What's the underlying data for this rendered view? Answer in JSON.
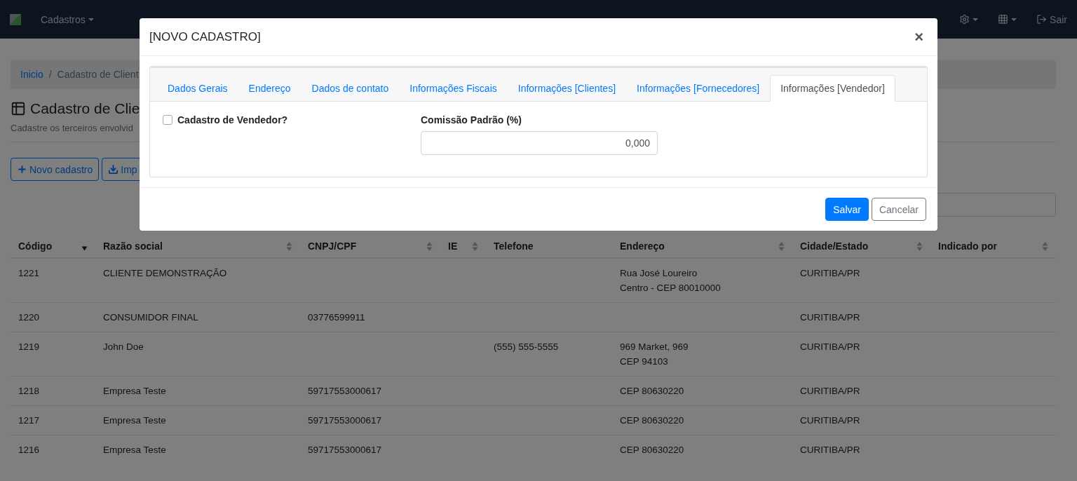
{
  "navbar": {
    "menu": [
      {
        "label": "Cadastros"
      }
    ],
    "logout": "Sair"
  },
  "breadcrumb": {
    "home": "Inicio",
    "separator": "/",
    "current": "Cadastro de Client"
  },
  "page": {
    "title": "Cadastro de Clie",
    "subtitle": "Cadastre os terceiros envolvid",
    "buttons": [
      {
        "kind": "new",
        "label": "Novo cadastro"
      },
      {
        "kind": "import",
        "label": "Imp"
      }
    ]
  },
  "table": {
    "columns": [
      {
        "label": "Código",
        "sortable": true,
        "sorted": true
      },
      {
        "label": "Razão social",
        "sortable": true,
        "sorted": false
      },
      {
        "label": "CNPJ/CPF",
        "sortable": true,
        "sorted": false
      },
      {
        "label": "IE",
        "sortable": true,
        "sorted": false
      },
      {
        "label": "Telefone",
        "sortable": false
      },
      {
        "label": "Endereço",
        "sortable": true,
        "sorted": false
      },
      {
        "label": "Cidade/Estado",
        "sortable": true,
        "sorted": false
      },
      {
        "label": "Indicado por",
        "sortable": true,
        "sorted": false
      }
    ],
    "rows": [
      {
        "cells": [
          "1221",
          "CLIENTE DEMONSTRAÇÃO",
          "",
          "",
          "",
          [
            "Rua José Loureiro",
            "Centro - CEP 80010000"
          ],
          "CURITIBA/PR",
          ""
        ]
      },
      {
        "cells": [
          "1220",
          "CONSUMIDOR FINAL",
          "03776599911",
          "",
          "",
          [],
          "CURITIBA/PR",
          ""
        ]
      },
      {
        "cells": [
          "1219",
          "John Doe",
          "",
          "",
          "(555) 555-5555",
          [
            "969 Market, 969",
            "CEP 94103"
          ],
          "CURITIBA/PR",
          ""
        ]
      },
      {
        "cells": [
          "1218",
          "Empresa Teste",
          "59717553000617",
          "",
          "",
          [
            "CEP 80630220"
          ],
          "CURITIBA/PR",
          ""
        ]
      },
      {
        "cells": [
          "1217",
          "Empresa Teste",
          "59717553000617",
          "",
          "",
          [
            "CEP 80630220"
          ],
          "CURITIBA/PR",
          ""
        ]
      },
      {
        "cells": [
          "1216",
          "Empresa Teste",
          "59717553000617",
          "",
          "",
          [
            "CEP 80630220"
          ],
          "CURITIBA/PR",
          ""
        ]
      }
    ]
  },
  "modal": {
    "title": "[NOVO CADASTRO]",
    "close": "×",
    "tabs": [
      {
        "label": "Dados Gerais",
        "selected": false
      },
      {
        "label": "Endereço",
        "selected": false
      },
      {
        "label": "Dados de contato",
        "selected": false
      },
      {
        "label": "Informações Fiscais",
        "selected": false
      },
      {
        "label": "Informações [Clientes]",
        "selected": false
      },
      {
        "label": "Informações [Fornecedores]",
        "selected": false
      },
      {
        "label": "Informações [Vendedor]",
        "selected": true
      }
    ],
    "checkbox": {
      "label": "Cadastro de Vendedor?",
      "checked": false
    },
    "commission": {
      "label": "Comissão Padrão (%)",
      "value": "0,000"
    },
    "buttons": [
      {
        "kind": "primary",
        "label": "Salvar"
      },
      {
        "kind": "secondary",
        "label": "Cancelar"
      }
    ]
  }
}
